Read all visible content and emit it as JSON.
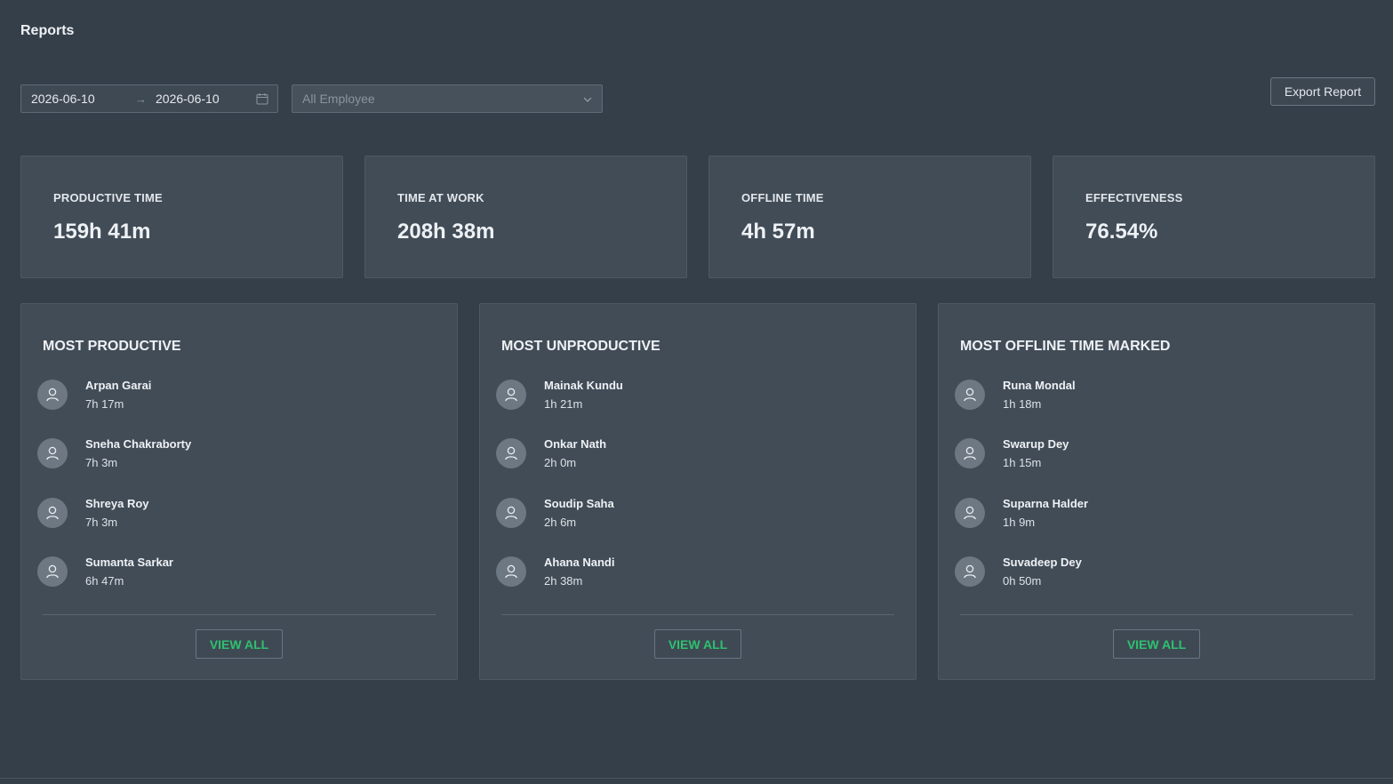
{
  "header": {
    "title": "Reports"
  },
  "filters": {
    "date_start": "2026-06-10",
    "date_separator": "→",
    "date_end": "2026-06-10",
    "employee_placeholder": "All Employee",
    "export_label": "Export Report"
  },
  "stats": [
    {
      "label": "PRODUCTIVE TIME",
      "value": "159h 41m"
    },
    {
      "label": "TIME AT WORK",
      "value": "208h 38m"
    },
    {
      "label": "OFFLINE TIME",
      "value": "4h 57m"
    },
    {
      "label": "EFFECTIVENESS",
      "value": "76.54%"
    }
  ],
  "lists": [
    {
      "title": "MOST PRODUCTIVE",
      "view_all": "VIEW ALL",
      "items": [
        {
          "name": "Arpan Garai",
          "time": "7h 17m"
        },
        {
          "name": "Sneha Chakraborty",
          "time": "7h 3m"
        },
        {
          "name": "Shreya Roy",
          "time": "7h 3m"
        },
        {
          "name": "Sumanta Sarkar",
          "time": "6h 47m"
        }
      ]
    },
    {
      "title": "MOST UNPRODUCTIVE",
      "view_all": "VIEW ALL",
      "items": [
        {
          "name": "Mainak Kundu",
          "time": "1h 21m"
        },
        {
          "name": "Onkar Nath",
          "time": "2h 0m"
        },
        {
          "name": "Soudip Saha",
          "time": "2h 6m"
        },
        {
          "name": "Ahana Nandi",
          "time": "2h 38m"
        }
      ]
    },
    {
      "title": "MOST OFFLINE TIME MARKED",
      "view_all": "VIEW ALL",
      "items": [
        {
          "name": "Runa Mondal",
          "time": "1h 18m"
        },
        {
          "name": "Swarup Dey",
          "time": "1h 15m"
        },
        {
          "name": "Suparna Halder",
          "time": "1h 9m"
        },
        {
          "name": "Suvadeep Dey",
          "time": "0h 50m"
        }
      ]
    }
  ],
  "colors": {
    "background": "#353f49",
    "card": "#414c57",
    "accent_green": "#2ec16f"
  },
  "icons": {
    "calendar": "calendar-icon",
    "chevron": "chevron-down-icon",
    "avatar": "user-icon"
  }
}
